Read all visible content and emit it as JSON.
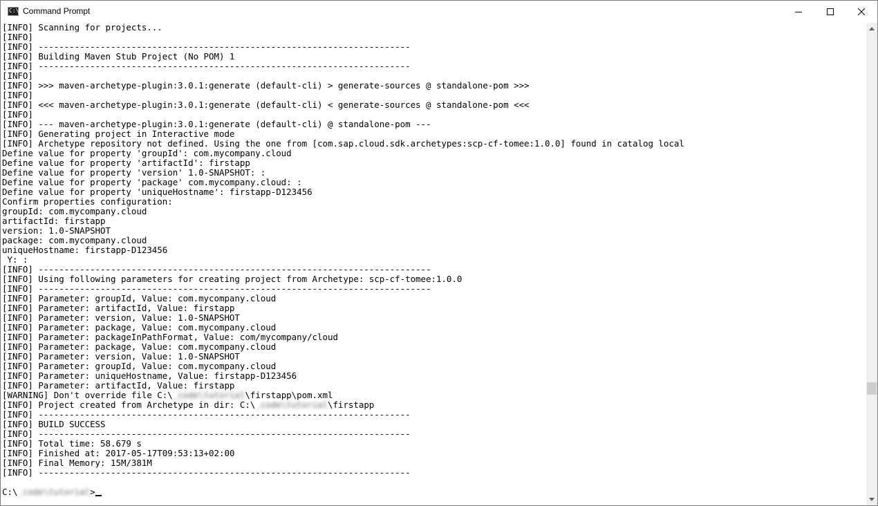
{
  "window": {
    "title": "Command Prompt"
  },
  "icons": {
    "app": "cmd-icon",
    "minimize": "minimize-icon",
    "maximize": "maximize-icon",
    "close": "close-icon",
    "scroll_up": "arrow-up-icon",
    "scroll_down": "arrow-down-icon"
  },
  "console": {
    "lines": [
      [
        "[INFO] Scanning for projects..."
      ],
      [
        "[INFO]"
      ],
      [
        "[INFO] ------------------------------------------------------------------------"
      ],
      [
        "[INFO] Building Maven Stub Project (No POM) 1"
      ],
      [
        "[INFO] ------------------------------------------------------------------------"
      ],
      [
        "[INFO]"
      ],
      [
        "[INFO] >>> maven-archetype-plugin:3.0.1:generate (default-cli) > generate-sources @ standalone-pom >>>"
      ],
      [
        "[INFO]"
      ],
      [
        "[INFO] <<< maven-archetype-plugin:3.0.1:generate (default-cli) < generate-sources @ standalone-pom <<<"
      ],
      [
        "[INFO]"
      ],
      [
        "[INFO] --- maven-archetype-plugin:3.0.1:generate (default-cli) @ standalone-pom ---"
      ],
      [
        "[INFO] Generating project in Interactive mode"
      ],
      [
        "[INFO] Archetype repository not defined. Using the one from [com.sap.cloud.sdk.archetypes:scp-cf-tomee:1.0.0] found in catalog local"
      ],
      [
        "Define value for property 'groupId': com.mycompany.cloud"
      ],
      [
        "Define value for property 'artifactId': firstapp"
      ],
      [
        "Define value for property 'version' 1.0-SNAPSHOT: :"
      ],
      [
        "Define value for property 'package' com.mycompany.cloud: :"
      ],
      [
        "Define value for property 'uniqueHostname': firstapp-D123456"
      ],
      [
        "Confirm properties configuration:"
      ],
      [
        "groupId: com.mycompany.cloud"
      ],
      [
        "artifactId: firstapp"
      ],
      [
        "version: 1.0-SNAPSHOT"
      ],
      [
        "package: com.mycompany.cloud"
      ],
      [
        "uniqueHostname: firstapp-D123456"
      ],
      [
        " Y: :"
      ],
      [
        "[INFO] ----------------------------------------------------------------------------"
      ],
      [
        "[INFO] Using following parameters for creating project from Archetype: scp-cf-tomee:1.0.0"
      ],
      [
        "[INFO] ----------------------------------------------------------------------------"
      ],
      [
        "[INFO] Parameter: groupId, Value: com.mycompany.cloud"
      ],
      [
        "[INFO] Parameter: artifactId, Value: firstapp"
      ],
      [
        "[INFO] Parameter: version, Value: 1.0-SNAPSHOT"
      ],
      [
        "[INFO] Parameter: package, Value: com.mycompany.cloud"
      ],
      [
        "[INFO] Parameter: packageInPathFormat, Value: com/mycompany/cloud"
      ],
      [
        "[INFO] Parameter: package, Value: com.mycompany.cloud"
      ],
      [
        "[INFO] Parameter: version, Value: 1.0-SNAPSHOT"
      ],
      [
        "[INFO] Parameter: groupId, Value: com.mycompany.cloud"
      ],
      [
        "[INFO] Parameter: uniqueHostname, Value: firstapp-D123456"
      ],
      [
        "[INFO] Parameter: artifactId, Value: firstapp"
      ],
      [
        "[WARNING] Don't override file C:\\",
        "_code\\tutorial",
        "\\firstapp\\pom.xml"
      ],
      [
        "[INFO] Project created from Archetype in dir: C:\\",
        "_code\\tutorial",
        "\\firstapp"
      ],
      [
        "[INFO] ------------------------------------------------------------------------"
      ],
      [
        "[INFO] BUILD SUCCESS"
      ],
      [
        "[INFO] ------------------------------------------------------------------------"
      ],
      [
        "[INFO] Total time: 58.679 s"
      ],
      [
        "[INFO] Finished at: 2017-05-17T09:53:13+02:00"
      ],
      [
        "[INFO] Final Memory: 15M/381M"
      ],
      [
        "[INFO] ------------------------------------------------------------------------"
      ],
      [
        ""
      ],
      [
        "C:\\",
        "_code\\tutorial",
        ">"
      ]
    ]
  }
}
